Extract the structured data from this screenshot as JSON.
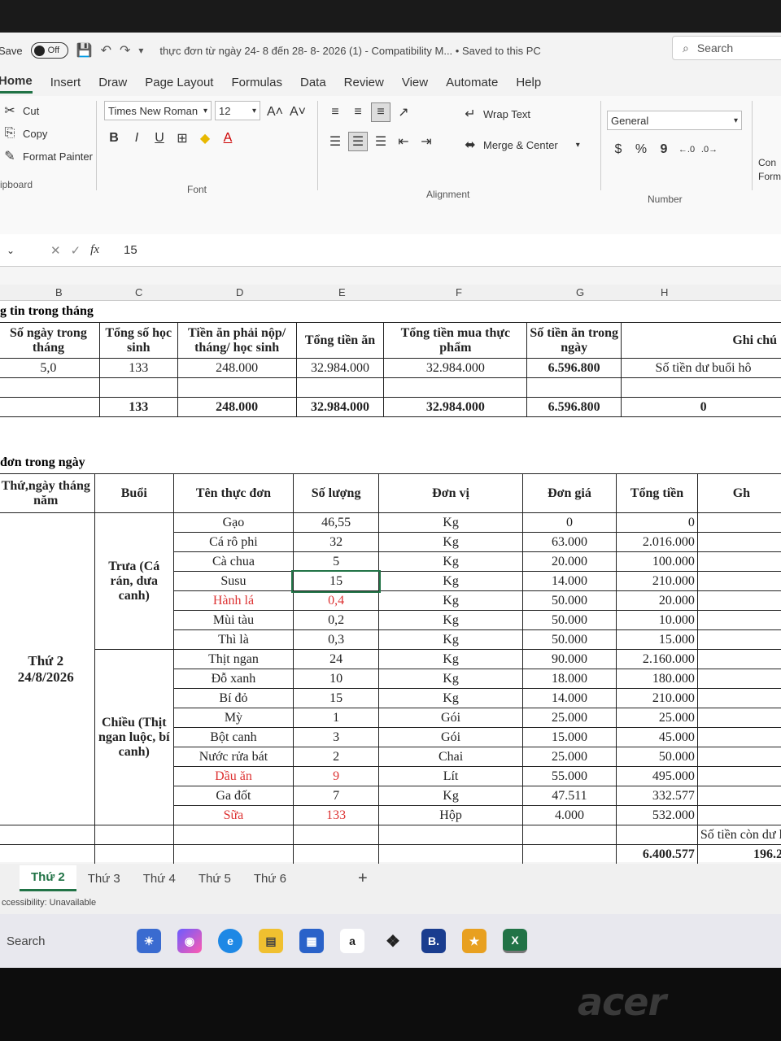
{
  "titlebar": {
    "autosave_label": "Save",
    "autosave_state": "Off",
    "document_title": "thực đơn từ ngày 24- 8  đến  28- 8- 2026 (1)  -  Compatibility M...  •  Saved to this PC",
    "search_label": "Search"
  },
  "menu": [
    "Home",
    "Insert",
    "Draw",
    "Page Layout",
    "Formulas",
    "Data",
    "Review",
    "View",
    "Automate",
    "Help"
  ],
  "ribbon": {
    "clipboard": {
      "cut": "Cut",
      "copy": "Copy",
      "format_painter": "Format Painter",
      "group": "Clipboard"
    },
    "font": {
      "name": "Times New Roman",
      "size": "12",
      "group": "Font",
      "bold": "B",
      "italic": "I",
      "underline": "U"
    },
    "alignment": {
      "wrap": "Wrap Text",
      "merge": "Merge & Center",
      "group": "Alignment"
    },
    "number": {
      "format": "General",
      "group": "Number",
      "currency": "$",
      "percent": "%",
      "comma": "9"
    },
    "conditional": "Con Form"
  },
  "formula": {
    "fx": "fx",
    "value": "15"
  },
  "columns": [
    "B",
    "C",
    "D",
    "E",
    "F",
    "G",
    "H"
  ],
  "top_section": {
    "caption": "g tin trong tháng",
    "headers": [
      "Số ngày trong tháng",
      "Tổng số học sinh",
      "Tiền ăn phải nộp/ tháng/ học sinh",
      "Tổng tiền ăn",
      "Tổng tiền mua thực phẩm",
      "Số tiền ăn trong ngày",
      "Ghi chú"
    ],
    "row1": [
      "5,0",
      "133",
      "248.000",
      "32.984.000",
      "32.984.000",
      "6.596.800",
      "Số tiền  dư buổi hô"
    ],
    "total": [
      "",
      "133",
      "248.000",
      "32.984.000",
      "32.984.000",
      "6.596.800",
      "0"
    ]
  },
  "menu_section": {
    "caption": "đơn trong ngày",
    "headers": [
      "Thứ,ngày tháng năm",
      "Buổi",
      "Tên thực đơn",
      "Số lượng",
      "Đơn vị",
      "Đơn giá",
      "Tổng tiền",
      "Gh"
    ],
    "day": "Thứ 2 24/8/2026",
    "session1": "Trưa (Cá rán, dưa canh)",
    "session2": "Chiều (Thịt ngan luộc, bí canh)",
    "items": [
      [
        "Gạo",
        "46,55",
        "Kg",
        "0",
        "0"
      ],
      [
        "Cá rô phi",
        "32",
        "Kg",
        "63.000",
        "2.016.000"
      ],
      [
        "Cà chua",
        "5",
        "Kg",
        "20.000",
        "100.000"
      ],
      [
        "Susu",
        "15",
        "Kg",
        "14.000",
        "210.000"
      ],
      [
        "Hành lá",
        "0,4",
        "Kg",
        "50.000",
        "20.000"
      ],
      [
        "Mùi tàu",
        "0,2",
        "Kg",
        "50.000",
        "10.000"
      ],
      [
        "Thì là",
        "0,3",
        "Kg",
        "50.000",
        "15.000"
      ],
      [
        "Thịt ngan",
        "24",
        "Kg",
        "90.000",
        "2.160.000"
      ],
      [
        "Đỗ xanh",
        "10",
        "Kg",
        "18.000",
        "180.000"
      ],
      [
        "Bí đỏ",
        "15",
        "Kg",
        "14.000",
        "210.000"
      ],
      [
        "Mỳ",
        "1",
        "Gói",
        "25.000",
        "25.000"
      ],
      [
        "Bột canh",
        "3",
        "Gói",
        "15.000",
        "45.000"
      ],
      [
        "Nước rửa bát",
        "2",
        "Chai",
        "25.000",
        "50.000"
      ],
      [
        "Dầu ăn",
        "9",
        "Lít",
        "55.000",
        "495.000"
      ],
      [
        "Ga đốt",
        "7",
        "Kg",
        "47.511",
        "332.577"
      ],
      [
        "Sữa",
        "133",
        "Hộp",
        "4.000",
        "532.000"
      ]
    ],
    "remaining_label": "Số tiền còn dư l",
    "grand_total": "6.400.577",
    "remaining_value": "196.2"
  },
  "tabs": [
    "Thứ 2",
    "Thứ 3",
    "Thứ 4",
    "Thứ 5",
    "Thứ 6",
    "+"
  ],
  "status": "ccessibility: Unavailable",
  "taskbar": {
    "search": "Search"
  },
  "brand": "acer"
}
